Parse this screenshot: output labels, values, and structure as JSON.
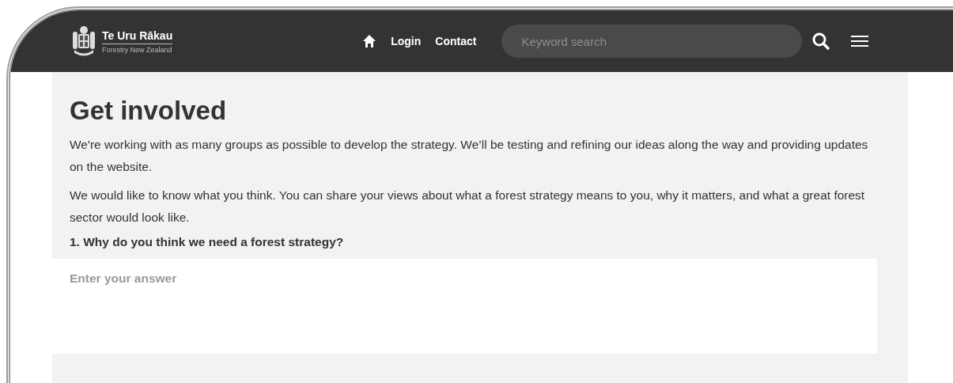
{
  "header": {
    "logo_title": "Te Uru Rākau",
    "logo_subtitle": "Forestry New Zealand"
  },
  "nav": [
    {
      "label": "Login"
    },
    {
      "label": "Contact"
    }
  ],
  "search": {
    "placeholder": "Keyword search"
  },
  "content": {
    "title": "Get involved",
    "paragraphs": [
      "We're working with as many groups as possible to develop the strategy. We’ll be testing and refining our ideas along the way and providing updates on the website.",
      "We would like to know what you think. You can share your views about what a forest strategy means to you, why it matters, and what a great forest sector would look like."
    ],
    "question": "1. Why do you think we need a forest strategy?",
    "answer": {
      "placeholder": "Enter your answer"
    }
  }
}
